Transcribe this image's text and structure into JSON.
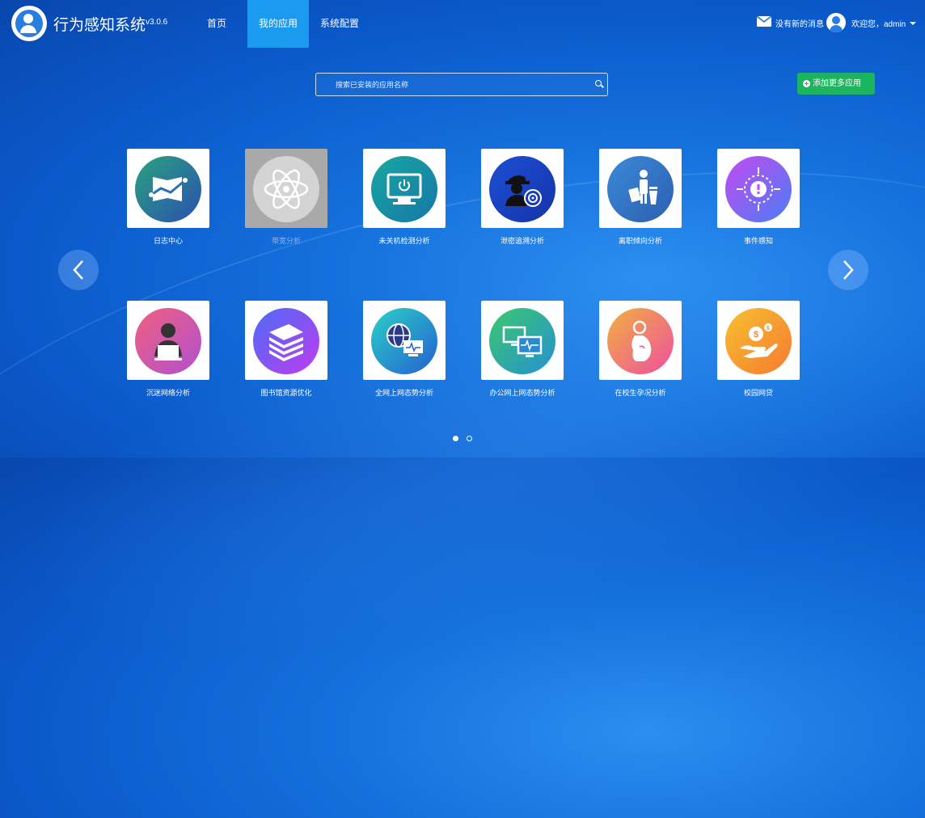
{
  "header": {
    "app_title": "行为感知系统",
    "version": "v3.0.6",
    "nav": [
      {
        "label": "首页",
        "active": false
      },
      {
        "label": "我的应用",
        "active": true
      },
      {
        "label": "系统配置",
        "active": false
      }
    ],
    "messages_text": "没有新的消息",
    "welcome_text": "欢迎您，admin",
    "icons": {
      "mail": "mail-icon",
      "avatar": "user-avatar-icon",
      "dropdown": "caret-down-icon"
    }
  },
  "search": {
    "placeholder": "搜索已安装的应用名称",
    "value": ""
  },
  "add_button": {
    "label": "添加更多应用"
  },
  "apps": [
    {
      "label": "日志中心",
      "icon": "log-chart-icon",
      "colors": [
        "#2aa37f",
        "#2b4fb0"
      ],
      "enabled": true
    },
    {
      "label": "带宽分析",
      "icon": "atom-icon",
      "colors": [
        "#d8d8d8",
        "#c4c4c4"
      ],
      "enabled": false
    },
    {
      "label": "未关机检测分析",
      "icon": "monitor-power-icon",
      "colors": [
        "#18a8a0",
        "#1676a8"
      ],
      "enabled": true
    },
    {
      "label": "泄密追溯分析",
      "icon": "spy-target-icon",
      "colors": [
        "#1e4fd6",
        "#1433a8"
      ],
      "enabled": true
    },
    {
      "label": "离职倾向分析",
      "icon": "person-trash-icon",
      "colors": [
        "#3a8ad8",
        "#2d5fb0"
      ],
      "enabled": true
    },
    {
      "label": "事件感知",
      "icon": "alert-target-icon",
      "colors": [
        "#c34bf0",
        "#4a7df5"
      ],
      "enabled": true
    },
    {
      "label": "沉迷网络分析",
      "icon": "person-laptop-icon",
      "colors": [
        "#f06080",
        "#b050d0"
      ],
      "enabled": true
    },
    {
      "label": "图书馆资源优化",
      "icon": "books-stack-icon",
      "colors": [
        "#4a6df5",
        "#c03bf0"
      ],
      "enabled": true
    },
    {
      "label": "全网上网态势分析",
      "icon": "globe-monitor-icon",
      "colors": [
        "#2ad0c8",
        "#2560d0"
      ],
      "enabled": true
    },
    {
      "label": "办公网上网态势分析",
      "icon": "dual-monitor-icon",
      "colors": [
        "#3cc870",
        "#2590d0"
      ],
      "enabled": true
    },
    {
      "label": "在校生孕况分析",
      "icon": "pregnant-woman-icon",
      "colors": [
        "#f2b040",
        "#ee4fa0"
      ],
      "enabled": true
    },
    {
      "label": "校园网贷",
      "icon": "hand-coin-icon",
      "colors": [
        "#f8c030",
        "#f57a30"
      ],
      "enabled": true
    }
  ],
  "pager": {
    "pages": 2,
    "current": 1
  }
}
